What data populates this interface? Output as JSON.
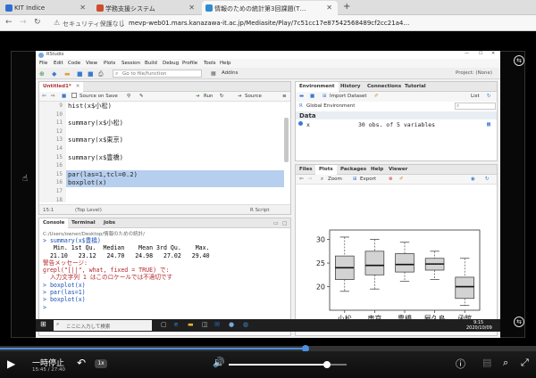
{
  "browser": {
    "tabs": [
      {
        "label": "KIT Indice",
        "color": "#2f6fd1"
      },
      {
        "label": "学務支援システム",
        "color": "#d14a2f"
      },
      {
        "label": "情報のための統計第3回課題(T…",
        "color": "#2f8ad1"
      }
    ],
    "security_label": "セキュリティ保護なし",
    "url": "mevp-web01.mars.kanazawa-it.ac.jp/Mediasite/Play/7c51cc17e87542568489cf2cc21a4…"
  },
  "rstudio": {
    "app_title": "RStudio",
    "menu": [
      "File",
      "Edit",
      "Code",
      "View",
      "Plots",
      "Session",
      "Build",
      "Debug",
      "Profile",
      "Tools",
      "Help"
    ],
    "goto_placeholder": "Go to file/function",
    "addins": "Addins",
    "project": "Project: (None)",
    "editor": {
      "tab": "Untitled1*",
      "source_on_save": "Source on Save",
      "run": "Run",
      "source": "Source",
      "lines": [
        {
          "n": "9",
          "text": "hist(x$小松)"
        },
        {
          "n": "10",
          "text": ""
        },
        {
          "n": "11",
          "text": "summary(x$小松)"
        },
        {
          "n": "12",
          "text": ""
        },
        {
          "n": "13",
          "text": "summary(x$東京)"
        },
        {
          "n": "14",
          "text": ""
        },
        {
          "n": "15",
          "text": "summary(x$豊橋)"
        },
        {
          "n": "16",
          "text": ""
        },
        {
          "n": "15",
          "text": "par(las=1,tcl=0.2)"
        },
        {
          "n": "16",
          "text": "boxplot(x)"
        },
        {
          "n": "17",
          "text": ""
        },
        {
          "n": "18",
          "text": ""
        }
      ],
      "status_pos": "15:1",
      "status_level": "(Top Level)",
      "status_type": "R Script"
    },
    "console": {
      "tabs": [
        "Console",
        "Terminal",
        "Jobs"
      ],
      "path": "C:/Users/owner/Desktop/情報のための統計/",
      "lines": [
        {
          "text": "> summary(x$豊橋)",
          "kind": "blue"
        },
        {
          "text": "   Min. 1st Qu.  Median    Mean 3rd Qu.    Max.",
          "kind": "plain"
        },
        {
          "text": "  21.10   23.12   24.70   24.98   27.02   29.40",
          "kind": "plain"
        },
        {
          "text": "警告メッセージ:",
          "kind": "red"
        },
        {
          "text": "grepl(\"[||\", what, fixed = TRUE) で:",
          "kind": "red"
        },
        {
          "text": "  入力文字列 1 はこのロケールでは不適切です",
          "kind": "red"
        },
        {
          "text": "> boxplot(x)",
          "kind": "blue"
        },
        {
          "text": "> par(las=1)",
          "kind": "blue"
        },
        {
          "text": "> boxplot(x)",
          "kind": "blue"
        },
        {
          "text": ">",
          "kind": "blue"
        }
      ]
    },
    "env": {
      "tabs": [
        "Environment",
        "History",
        "Connections",
        "Tutorial"
      ],
      "import_dataset": "Import Dataset",
      "list_label": "List",
      "global_env": "Global Environment",
      "section": "Data",
      "var_name": "x",
      "var_value": "30 obs. of 5 variables"
    },
    "files": {
      "tabs": [
        "Files",
        "Plots",
        "Packages",
        "Help",
        "Viewer"
      ],
      "zoom": "Zoom",
      "export": "Export"
    }
  },
  "taskbar": {
    "search_placeholder": "ここに入力して検索",
    "time": "9:15",
    "date": "2020/10/09"
  },
  "player": {
    "pause_label": "一時停止",
    "time": "15:45 / 27:40",
    "speed": "1x",
    "progress": 0.57,
    "volume": 0.83
  },
  "chart_data": {
    "type": "boxplot",
    "categories": [
      "小松",
      "東京",
      "豊橋",
      "屋久島",
      "函館"
    ],
    "ylim": [
      15,
      32
    ],
    "yticks": [
      20,
      25,
      30
    ],
    "boxes": [
      {
        "name": "小松",
        "min": 19.0,
        "q1": 21.5,
        "median": 24.0,
        "q3": 26.5,
        "max": 30.5
      },
      {
        "name": "東京",
        "min": 19.5,
        "q1": 22.5,
        "median": 24.5,
        "q3": 27.5,
        "max": 30.0
      },
      {
        "name": "豊橋",
        "min": 21.1,
        "q1": 23.1,
        "median": 24.7,
        "q3": 27.0,
        "max": 29.4
      },
      {
        "name": "屋久島",
        "min": 21.5,
        "q1": 23.5,
        "median": 24.8,
        "q3": 26.0,
        "max": 27.5
      },
      {
        "name": "函館",
        "min": 16.0,
        "q1": 17.5,
        "median": 20.0,
        "q3": 22.0,
        "max": 26.0
      }
    ]
  }
}
